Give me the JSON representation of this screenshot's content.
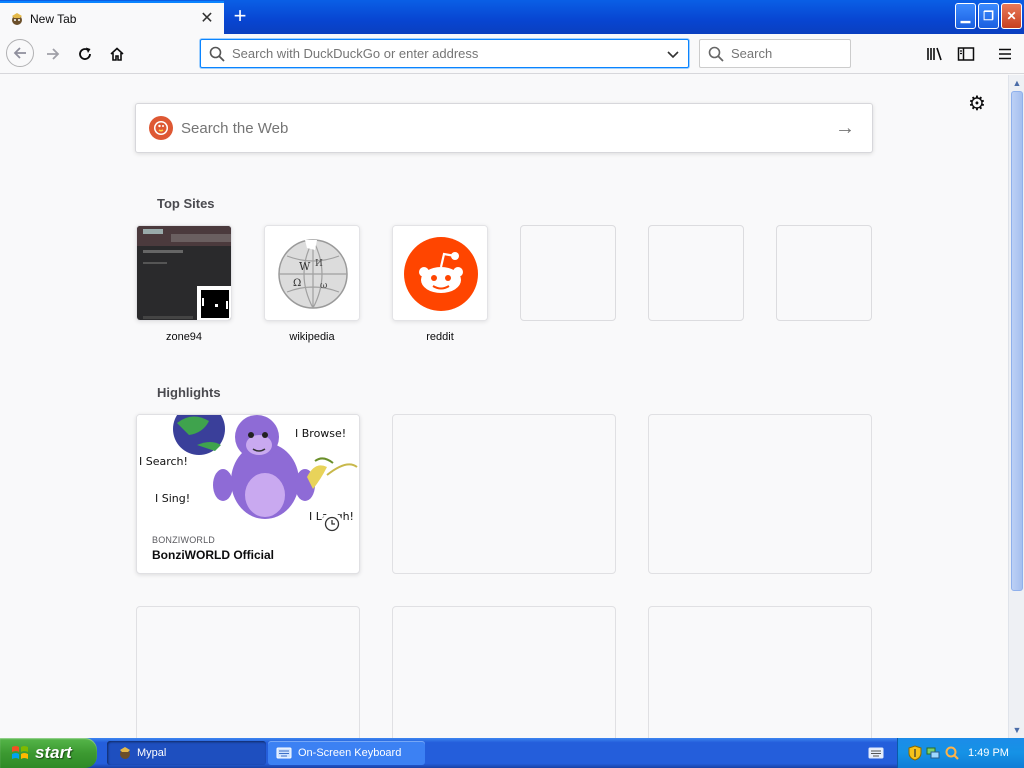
{
  "browser": {
    "tab": {
      "title": "New Tab",
      "close_glyph": "✕"
    },
    "newtab_glyph": "+",
    "window_buttons": {
      "minimize": "▁",
      "restore": "❐",
      "close": "✕"
    },
    "url_placeholder": "Search with DuckDuckGo or enter address",
    "search_placeholder": "Search"
  },
  "newtab": {
    "websearch_placeholder": "Search the Web",
    "websearch_go": "→",
    "gear_glyph": "⚙",
    "top_sites_title": "Top Sites",
    "top_sites": [
      {
        "label": "zone94"
      },
      {
        "label": "wikipedia"
      },
      {
        "label": "reddit"
      },
      {
        "label": ""
      },
      {
        "label": ""
      },
      {
        "label": ""
      }
    ],
    "highlights_title": "Highlights",
    "highlight": {
      "host": "BONZIWORLD",
      "title": "BonziWORLD Official",
      "speech": [
        "I Browse!",
        "I Search!",
        "I Sing!",
        "I Laugh!"
      ]
    }
  },
  "taskbar": {
    "start_label": "start",
    "items": [
      "Mypal",
      "On-Screen Keyboard"
    ],
    "clock": "1:49 PM"
  },
  "colors": {
    "accent": "#0a84ff",
    "reddit": "#ff4500",
    "ddg": "#de5833",
    "xp_blue": "#245edb",
    "xp_green": "#3c9a31"
  }
}
